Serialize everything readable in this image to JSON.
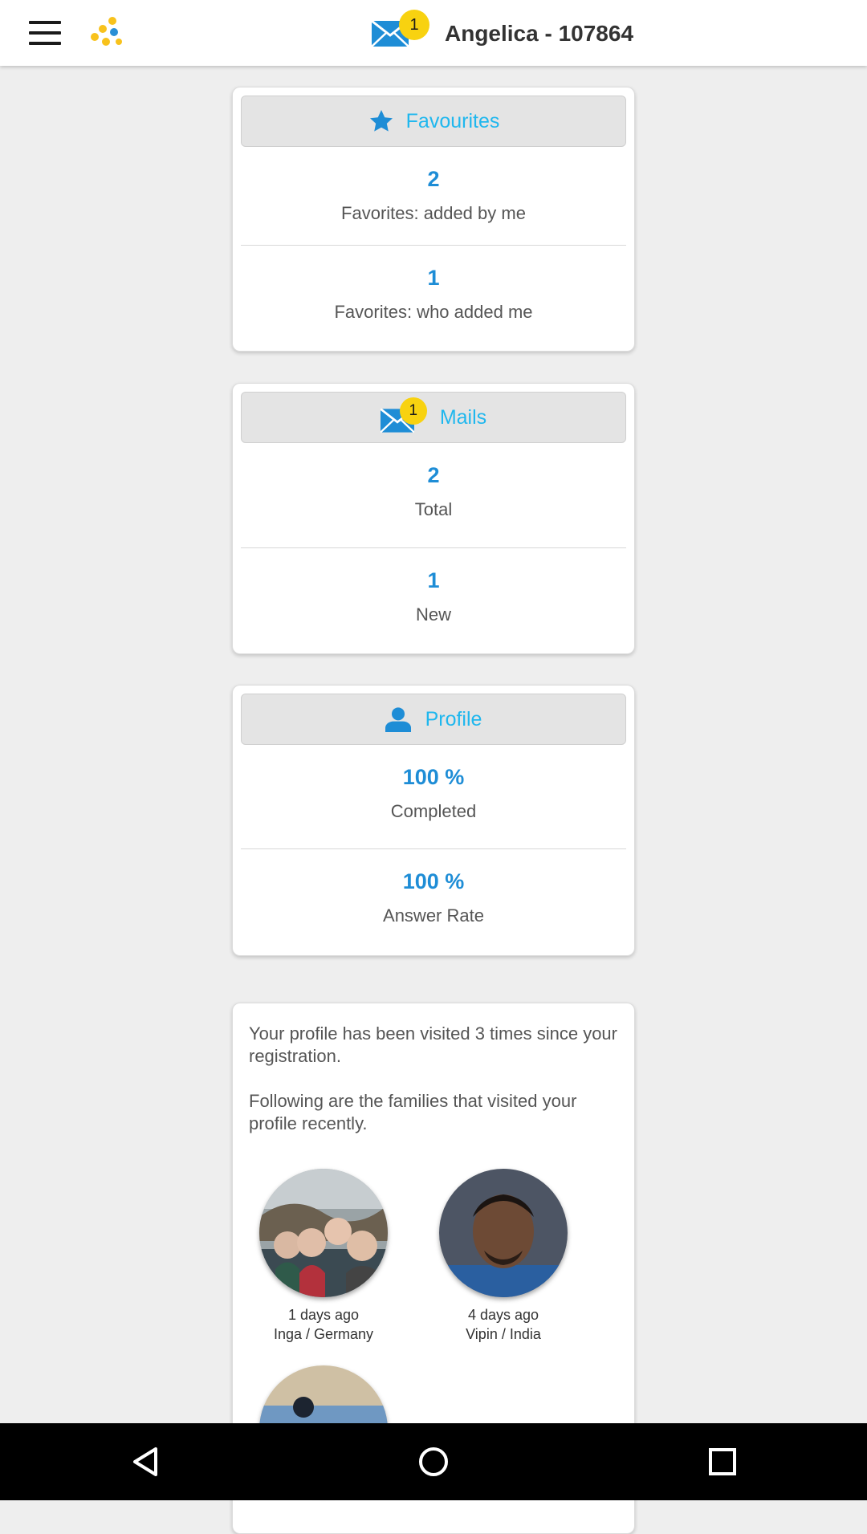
{
  "header": {
    "title": "Angelica - 107864",
    "mail_badge": "1"
  },
  "favourites": {
    "title": "Favourites",
    "stats": [
      {
        "value": "2",
        "label": "Favorites: added by me"
      },
      {
        "value": "1",
        "label": "Favorites: who added me"
      }
    ]
  },
  "mails": {
    "title": "Mails",
    "badge": "1",
    "stats": [
      {
        "value": "2",
        "label": "Total"
      },
      {
        "value": "1",
        "label": "New"
      }
    ]
  },
  "profile": {
    "title": "Profile",
    "stats": [
      {
        "value": "100 %",
        "label": "Completed"
      },
      {
        "value": "100 %",
        "label": "Answer Rate"
      }
    ]
  },
  "visits": {
    "intro": "Your profile has been visited 3 times since your registration.",
    "recent": "Following are the families that visited your profile recently.",
    "visitors": [
      {
        "when": "1 days ago",
        "who": "Inga / Germany"
      },
      {
        "when": "4 days ago",
        "who": "Vipin / India"
      }
    ]
  },
  "colors": {
    "accent": "#1fb7ee",
    "number": "#1e8dd6",
    "badge": "#f8d210",
    "mail_icon": "#1e8dd6"
  }
}
